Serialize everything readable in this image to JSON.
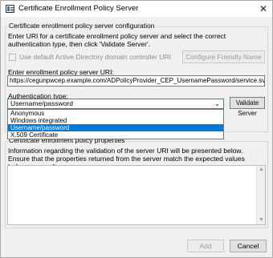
{
  "window": {
    "title": "Certificate Enrollment Policy Server",
    "close_glyph": "✕"
  },
  "config_group": {
    "legend": "Certificate enrollment policy server configuration",
    "instructions": "Enter URI for a certificate enrollment policy server and select the correct authentication type, then click 'Validate Server'.",
    "default_ad_checkbox_label": "Use default Active Directory domain controller URI",
    "default_ad_checked": false,
    "configure_friendly_name_button": "Configure Friendly Name",
    "uri_label": "Enter enrollment policy server URI:",
    "uri_value": "https://cegunpwcep.example.com/ADPolicyProvider_CEP_UsernamePassword/service.svc/CEP",
    "auth_label": "Authentication type:",
    "auth_selected": "Username/password",
    "auth_options": [
      "Anonymous",
      "Windows integrated",
      "Username/password",
      "X.509 Certificate"
    ],
    "auth_highlighted_index": 2,
    "validate_button": "Validate Server"
  },
  "properties_group": {
    "legend": "Certificate enrollment policy properties",
    "info": "Information regarding the validation of the server URI will be presented below. Ensure that the properties returned from the server match the expected values before proceeding."
  },
  "footer": {
    "add_button": "Add",
    "cancel_button": "Cancel"
  },
  "icons": {
    "title": "certificate-icon",
    "dropdown": "chevron-down-icon",
    "scroll_up": "scroll-up-arrow-icon",
    "scroll_down": "scroll-down-arrow-icon"
  }
}
